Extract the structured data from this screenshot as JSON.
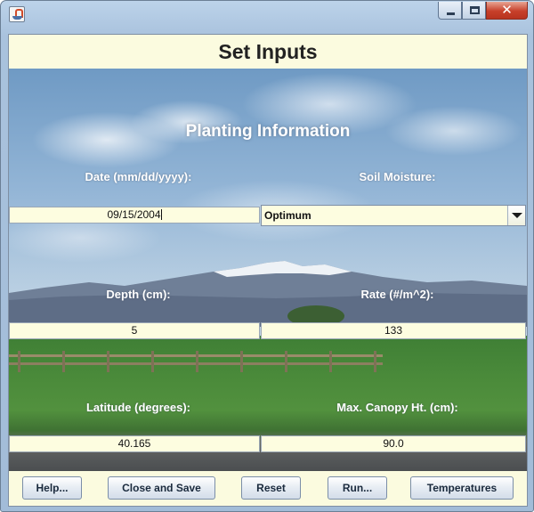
{
  "window": {
    "title": ""
  },
  "header": {
    "title": "Set Inputs"
  },
  "section": {
    "title": "Planting Information"
  },
  "fields": {
    "date": {
      "label": "Date (mm/dd/yyyy):",
      "value": "09/15/2004"
    },
    "soil_moisture": {
      "label": "Soil Moisture:",
      "selected": "Optimum"
    },
    "depth": {
      "label": "Depth (cm):",
      "value": "5"
    },
    "rate": {
      "label": "Rate (#/m^2):",
      "value": "133"
    },
    "latitude": {
      "label": "Latitude (degrees):",
      "value": "40.165"
    },
    "canopy": {
      "label": "Max. Canopy Ht. (cm):",
      "value": "90.0"
    }
  },
  "buttons": {
    "help": "Help...",
    "close_save": "Close and Save",
    "reset": "Reset",
    "run": "Run...",
    "temperatures": "Temperatures"
  },
  "colors": {
    "panel_bg": "#fbfbdf",
    "field_bg": "#fdfde0",
    "label_text": "#ffffff",
    "close_button": "#c7402a"
  },
  "icons": {
    "app": "java-icon",
    "minimize": "minimize-icon",
    "maximize": "maximize-icon",
    "close": "close-icon",
    "dropdown": "chevron-down-icon"
  }
}
